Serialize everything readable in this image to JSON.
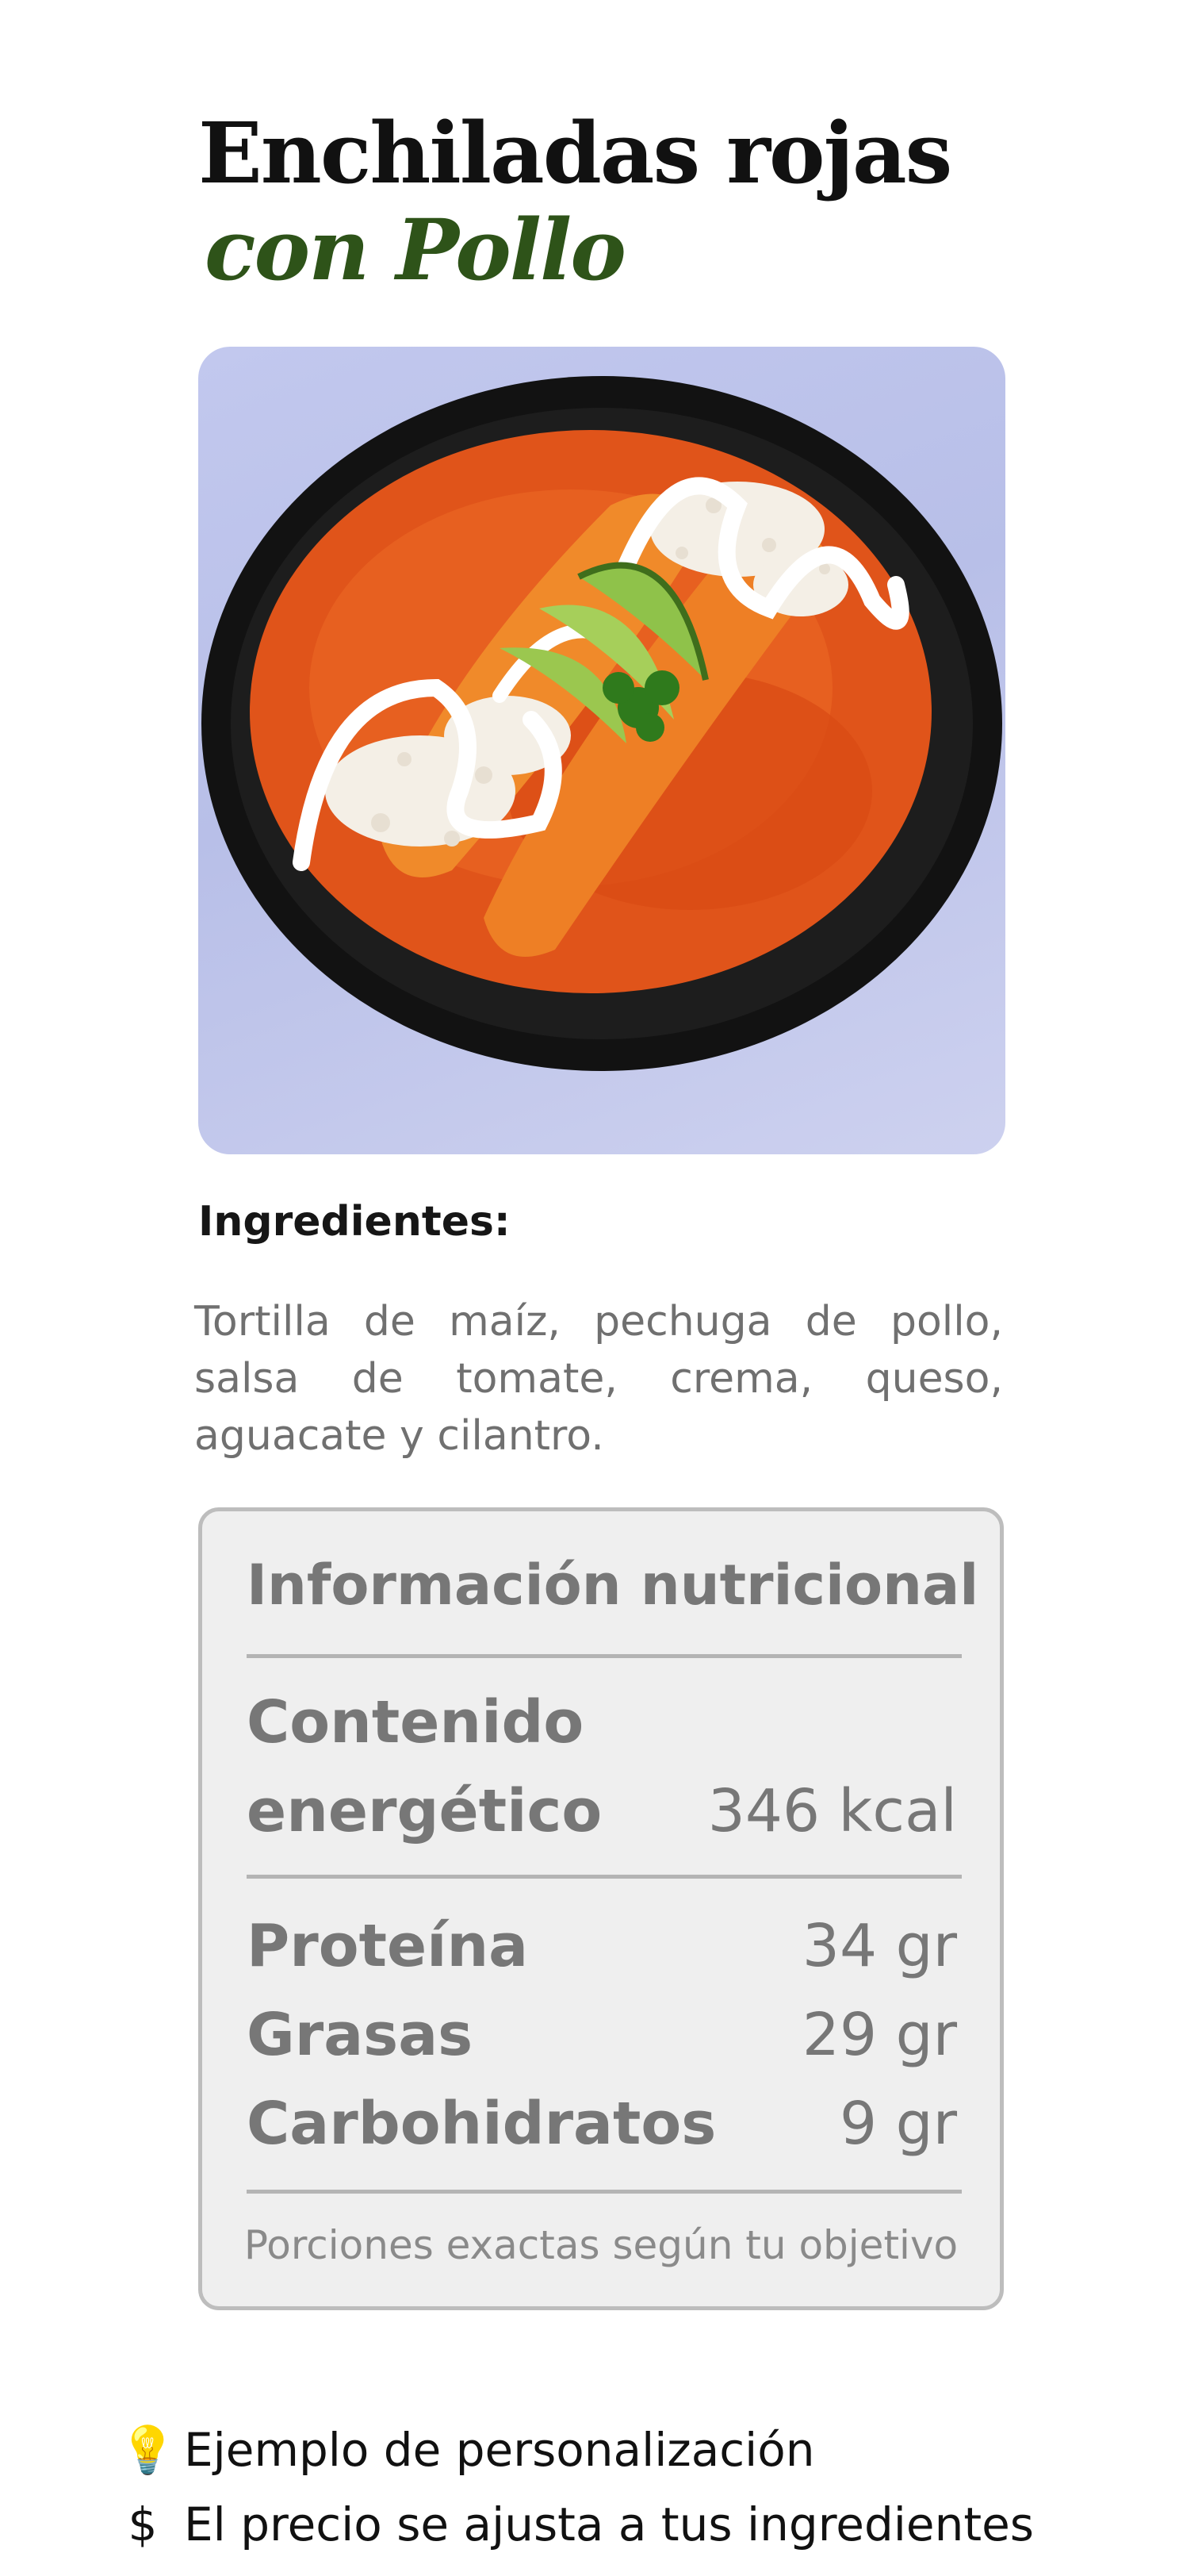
{
  "title": {
    "line1": "Enchiladas rojas",
    "line2": "con Pollo"
  },
  "image": {
    "alt": "enchiladas-photo"
  },
  "ingredients": {
    "heading": "Ingredientes:",
    "text": "Tortilla de maíz, pechuga de pollo, salsa de tomate, crema, queso, aguacate y cilantro."
  },
  "nutrition": {
    "title": "Información nutricional",
    "energy": {
      "label_line1": "Contenido",
      "label_line2": "energético",
      "value": "346 kcal"
    },
    "rows": [
      {
        "label": "Proteína",
        "value": "34 gr"
      },
      {
        "label": "Grasas",
        "value": "29 gr"
      },
      {
        "label": "Carbohidratos",
        "value": "9 gr"
      }
    ],
    "note": "Porciones exactas según tu objetivo"
  },
  "footer": {
    "items": [
      {
        "icon": "lightbulb-icon",
        "glyph": "💡",
        "text": "Ejemplo de personalización"
      },
      {
        "icon": "dollar-icon",
        "glyph": "$",
        "text": "El precio se ajusta a tus ingredientes"
      }
    ]
  },
  "colors": {
    "title": "#111111",
    "accent": "#2e5319",
    "muted_text": "#777777",
    "panel_bg": "#efefef",
    "panel_border": "#bdbdbd"
  }
}
